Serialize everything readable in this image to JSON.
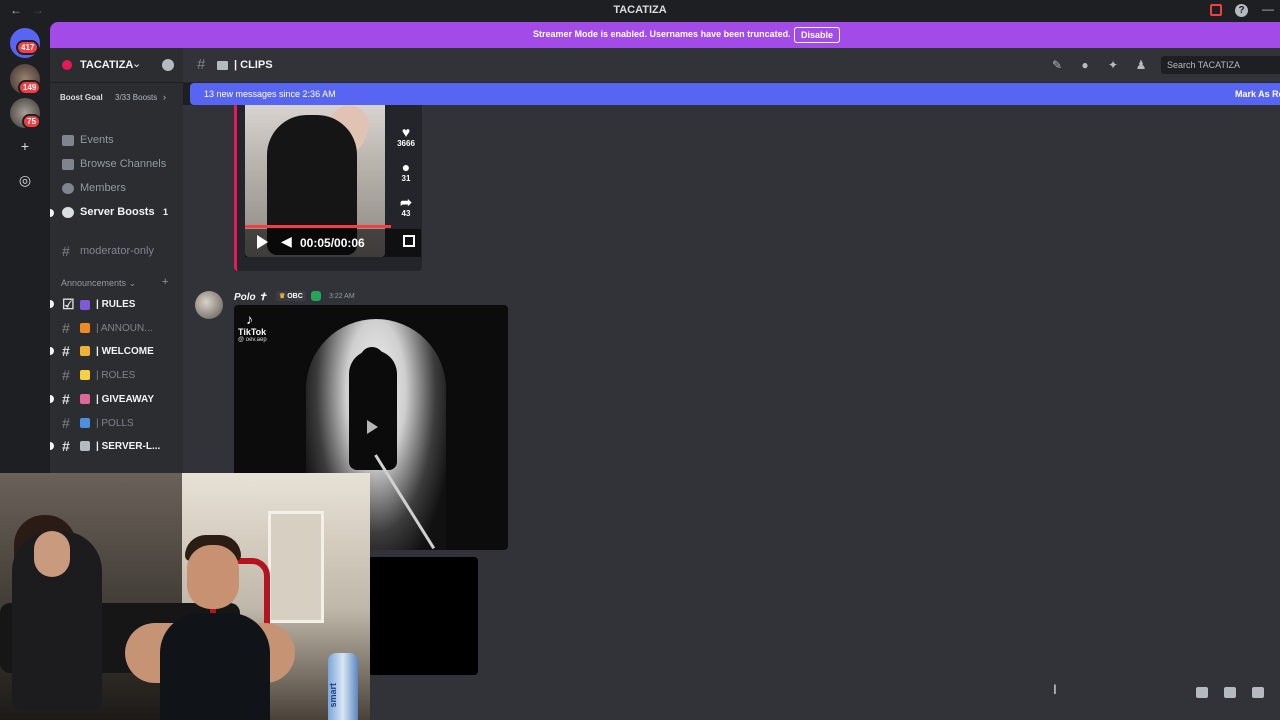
{
  "titlebar": {
    "title": "TACATIZA",
    "back": "←",
    "forward": "→",
    "help": "?",
    "minimize": "—"
  },
  "rail": {
    "badges": [
      "417",
      "149",
      "75"
    ],
    "add": "+",
    "explore": "◎"
  },
  "streamer": {
    "message": "Streamer Mode is enabled. Usernames have been truncated.",
    "button": "Disable"
  },
  "guild": {
    "name": "TACATIZA",
    "chevron": "⌄",
    "boost_goal": "Boost Goal",
    "boost_progress": "3/33 Boosts",
    "boost_arrow": "›"
  },
  "nav": [
    {
      "label": "Events",
      "icon": "calendar-icon"
    },
    {
      "label": "Browse Channels",
      "icon": "browse-icon"
    },
    {
      "label": "Members",
      "icon": "members-icon"
    },
    {
      "label": "Server Boosts",
      "icon": "boost-icon",
      "count": "1"
    }
  ],
  "channels": {
    "moderator": "moderator-only",
    "category": "Announcements",
    "category_chevron": "⌄",
    "category_add": "+",
    "items": [
      {
        "name": "| RULES",
        "emoji_color": "#7c5ad8",
        "bold": true,
        "unread": true
      },
      {
        "name": "| ANNOUN...",
        "emoji_color": "#f08a24",
        "bold": false,
        "unread": false
      },
      {
        "name": "| WELCOME",
        "emoji_color": "#f0b232",
        "bold": true,
        "unread": true
      },
      {
        "name": "| ROLES",
        "emoji_color": "#f5d142",
        "bold": false,
        "unread": false
      },
      {
        "name": "| GIVEAWAY",
        "emoji_color": "#e0679a",
        "bold": true,
        "unread": true
      },
      {
        "name": "| POLLS",
        "emoji_color": "#4f8fe0",
        "bold": false,
        "unread": false
      },
      {
        "name": "| SERVER-L...",
        "emoji_color": "#b5bac1",
        "bold": true,
        "unread": true
      }
    ]
  },
  "header": {
    "channel": "| CLIPS",
    "search_placeholder": "Search TACATIZA"
  },
  "newbar": {
    "left": "13 new messages since 2:36 AM",
    "right": "Mark As Read"
  },
  "video1": {
    "likes": "3666",
    "comments": "31",
    "shares": "43",
    "time": "00:05/00:06",
    "progress": 0.83
  },
  "message": {
    "author": "Polo",
    "author_mark": "✝",
    "tag": "OBC",
    "time": "3:22 AM"
  },
  "video2": {
    "brand": "TikTok",
    "handle": "@ oev.aep"
  },
  "webcam": {
    "bottle_text": "smart"
  },
  "colors": {
    "accent": "#5865f2",
    "streamer": "#a34be8",
    "alert": "#f23f43",
    "highlight": "#e6195d"
  }
}
